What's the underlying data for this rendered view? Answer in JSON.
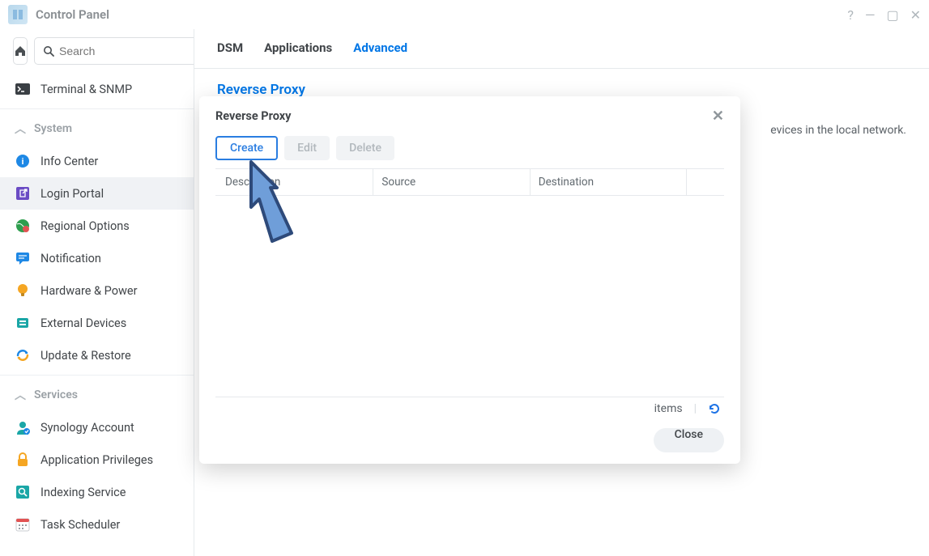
{
  "window": {
    "title": "Control Panel"
  },
  "search": {
    "placeholder": "Search"
  },
  "sidebar": {
    "top_item": {
      "label": "Terminal & SNMP"
    },
    "section_system": "System",
    "items_system": [
      {
        "name": "info-center",
        "label": "Info Center"
      },
      {
        "name": "login-portal",
        "label": "Login Portal"
      },
      {
        "name": "regional-options",
        "label": "Regional Options"
      },
      {
        "name": "notification",
        "label": "Notification"
      },
      {
        "name": "hardware-power",
        "label": "Hardware & Power"
      },
      {
        "name": "external-devices",
        "label": "External Devices"
      },
      {
        "name": "update-restore",
        "label": "Update & Restore"
      }
    ],
    "section_services": "Services",
    "items_services": [
      {
        "name": "synology-account",
        "label": "Synology Account"
      },
      {
        "name": "application-privileges",
        "label": "Application Privileges"
      },
      {
        "name": "indexing-service",
        "label": "Indexing Service"
      },
      {
        "name": "task-scheduler",
        "label": "Task Scheduler"
      }
    ]
  },
  "tabs": [
    "DSM",
    "Applications",
    "Advanced"
  ],
  "main": {
    "section_title": "Reverse Proxy",
    "section_desc_suffix": "evices in the local network."
  },
  "modal": {
    "title": "Reverse Proxy",
    "buttons": {
      "create": "Create",
      "edit": "Edit",
      "delete": "Delete"
    },
    "columns": [
      "Description",
      "Source",
      "Destination",
      ""
    ],
    "status_items": "items",
    "close": "Close"
  }
}
